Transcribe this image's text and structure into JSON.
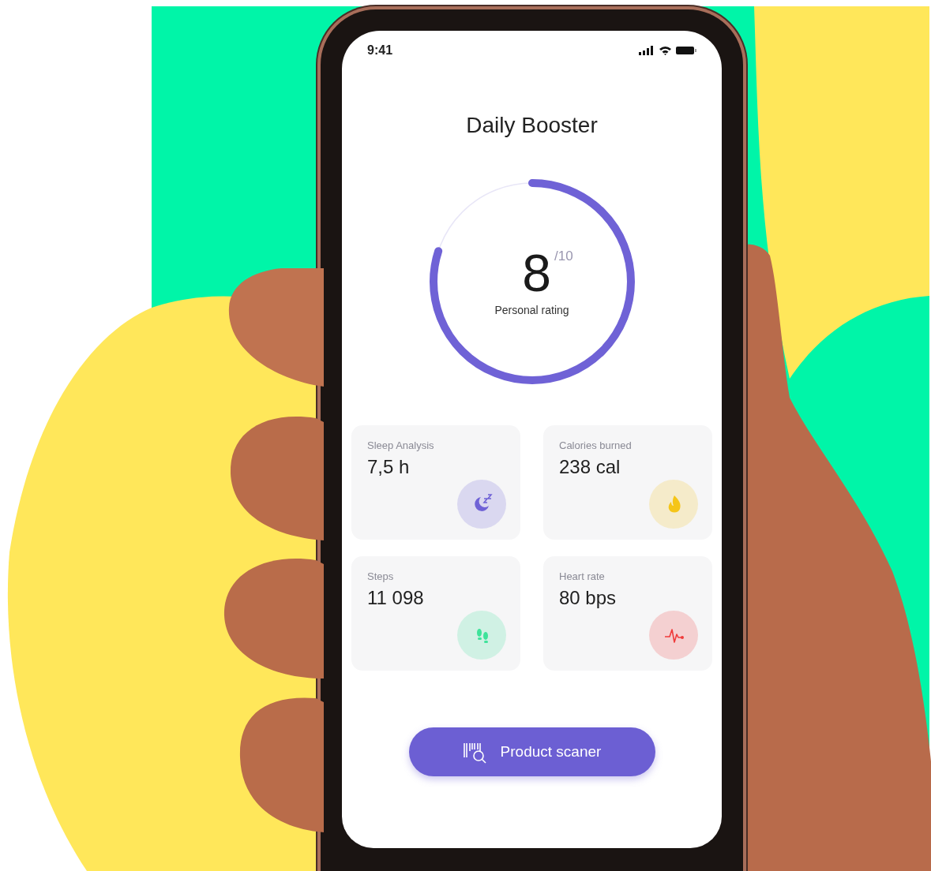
{
  "status_bar": {
    "time": "9:41"
  },
  "title": "Daily Booster",
  "rating": {
    "value": "8",
    "scale": "/10",
    "label": "Personal rating",
    "level": 0.8
  },
  "cards": [
    {
      "kind": "sleep",
      "label": "Sleep Analysis",
      "value": "7,5 h",
      "color": "#6f62d6"
    },
    {
      "kind": "calories",
      "label": "Calories burned",
      "value": "238 cal",
      "color": "#f5c518"
    },
    {
      "kind": "steps",
      "label": "Steps",
      "value": "11 098",
      "color": "#3ee39a"
    },
    {
      "kind": "heart",
      "label": "Heart rate",
      "value": "80 bps",
      "color": "#ef3b3b"
    }
  ],
  "button": {
    "label": "Product scaner"
  }
}
